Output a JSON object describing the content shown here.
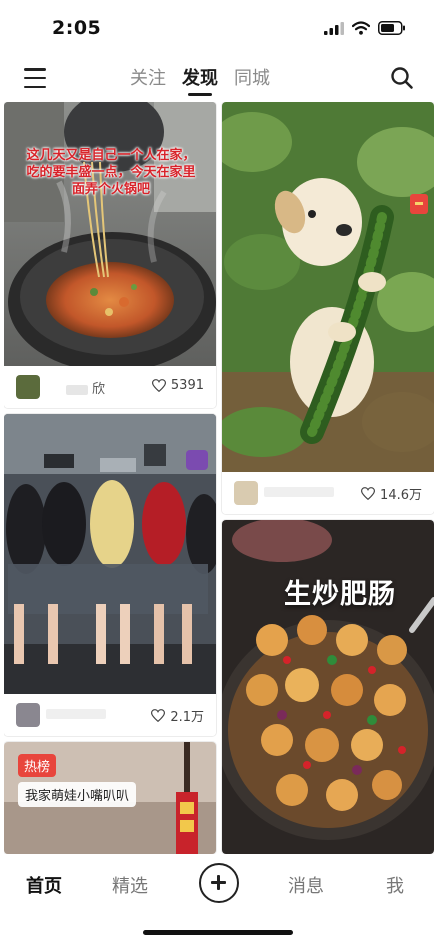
{
  "status_bar": {
    "time": "2:05"
  },
  "top_nav": {
    "tabs": [
      {
        "label": "关注",
        "active": false
      },
      {
        "label": "发现",
        "active": true
      },
      {
        "label": "同城",
        "active": false
      }
    ]
  },
  "feed": {
    "cards": [
      {
        "overlay_text": "这几天又是自己一个人在家，吃的要丰盛一点，今天在家里面弄个火锅吧",
        "author": "欣",
        "likes": "5391"
      },
      {
        "author": "",
        "likes": "14.6万"
      },
      {
        "author": "",
        "likes": "2.1万"
      },
      {
        "title_text": "生炒肥肠"
      },
      {
        "badge": "热榜",
        "caption": "我家萌娃小嘴叭叭"
      }
    ]
  },
  "bottom_nav": {
    "items": [
      {
        "label": "首页",
        "active": true
      },
      {
        "label": "精选",
        "active": false
      },
      {
        "label": "消息",
        "active": false
      },
      {
        "label": "我",
        "active": false
      }
    ]
  },
  "colors": {
    "accent_red": "#e8453c",
    "text_dark": "#1a1a1a",
    "text_muted": "#8a8a8a"
  }
}
